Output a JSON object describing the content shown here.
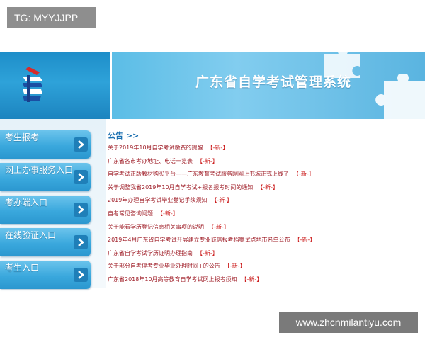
{
  "overlay_tag": "TG: MYYJJPP",
  "banner": {
    "title": "广东省自学考试管理系统"
  },
  "sidebar": {
    "items": [
      {
        "label": "考生报考"
      },
      {
        "label": "网上办事服务入口"
      },
      {
        "label": "考办端入口"
      },
      {
        "label": "在线验证入口"
      },
      {
        "label": "考生入口"
      }
    ]
  },
  "notices": {
    "heading": "公告 >>",
    "new_badge": "【-新-】",
    "items": [
      {
        "text": "关于2019年10月自学考试缴费的提醒"
      },
      {
        "text": "广东省各市考办地址、电话一览表"
      },
      {
        "text": "自学考试正版教材购买平台——广东教育考试服务网网上书城正式上线了"
      },
      {
        "text": "关于调整我省2019年10月自学考试+报名报考时间的通知"
      },
      {
        "text": "2019年办理自学考试毕业登记手续须知"
      },
      {
        "text": "自考常见咨询问题"
      },
      {
        "text": "关于能看学历登记信息相关事项的说明"
      },
      {
        "text": "2019年4月广东省自学考试开展建立专业诚信报考档案试点地市名单公布"
      },
      {
        "text": "广东省自学考试学历证明办理指南"
      },
      {
        "text": "关于部分自考停考专业毕业办理时间+的公告"
      },
      {
        "text": "广东省2018年10月高等教育自学考试网上报考须知"
      }
    ]
  },
  "watermark": "www.zhcnmilantiyu.com",
  "colors": {
    "banner_blue": "#2ea2d9",
    "nav_blue": "#3aa8dd",
    "notice_text": "#a0202a",
    "heading_blue": "#1a6fb0"
  }
}
